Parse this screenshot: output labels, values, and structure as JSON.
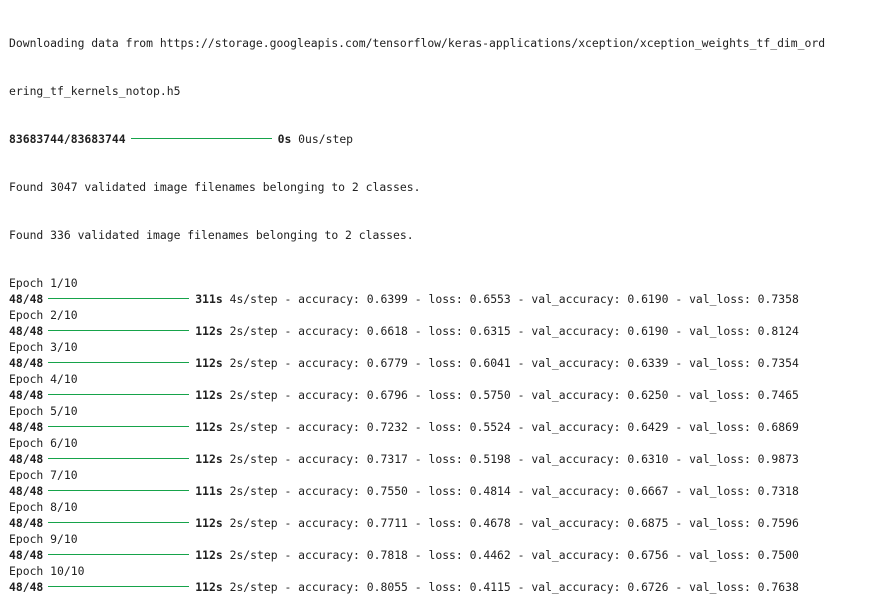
{
  "download": {
    "line1": "Downloading data from https://storage.googleapis.com/tensorflow/keras-applications/xception/xception_weights_tf_dim_ord",
    "line2": "ering_tf_kernels_notop.h5",
    "count": "83683744/83683744",
    "time": "0s",
    "rate": "0us/step"
  },
  "found": [
    "Found 3047 validated image filenames belonging to 2 classes.",
    "Found 336 validated image filenames belonging to 2 classes."
  ],
  "epochs": [
    {
      "label": "Epoch 1/10",
      "steps": "48/48",
      "time": "311s",
      "rate": "4s/step",
      "metrics": "- accuracy: 0.6399 - loss: 0.6553 - val_accuracy: 0.6190 - val_loss: 0.7358"
    },
    {
      "label": "Epoch 2/10",
      "steps": "48/48",
      "time": "112s",
      "rate": "2s/step",
      "metrics": "- accuracy: 0.6618 - loss: 0.6315 - val_accuracy: 0.6190 - val_loss: 0.8124"
    },
    {
      "label": "Epoch 3/10",
      "steps": "48/48",
      "time": "112s",
      "rate": "2s/step",
      "metrics": "- accuracy: 0.6779 - loss: 0.6041 - val_accuracy: 0.6339 - val_loss: 0.7354"
    },
    {
      "label": "Epoch 4/10",
      "steps": "48/48",
      "time": "112s",
      "rate": "2s/step",
      "metrics": "- accuracy: 0.6796 - loss: 0.5750 - val_accuracy: 0.6250 - val_loss: 0.7465"
    },
    {
      "label": "Epoch 5/10",
      "steps": "48/48",
      "time": "112s",
      "rate": "2s/step",
      "metrics": "- accuracy: 0.7232 - loss: 0.5524 - val_accuracy: 0.6429 - val_loss: 0.6869"
    },
    {
      "label": "Epoch 6/10",
      "steps": "48/48",
      "time": "112s",
      "rate": "2s/step",
      "metrics": "- accuracy: 0.7317 - loss: 0.5198 - val_accuracy: 0.6310 - val_loss: 0.9873"
    },
    {
      "label": "Epoch 7/10",
      "steps": "48/48",
      "time": "111s",
      "rate": "2s/step",
      "metrics": "- accuracy: 0.7550 - loss: 0.4814 - val_accuracy: 0.6667 - val_loss: 0.7318"
    },
    {
      "label": "Epoch 8/10",
      "steps": "48/48",
      "time": "112s",
      "rate": "2s/step",
      "metrics": "- accuracy: 0.7711 - loss: 0.4678 - val_accuracy: 0.6875 - val_loss: 0.7596"
    },
    {
      "label": "Epoch 9/10",
      "steps": "48/48",
      "time": "112s",
      "rate": "2s/step",
      "metrics": "- accuracy: 0.7818 - loss: 0.4462 - val_accuracy: 0.6756 - val_loss: 0.7500"
    },
    {
      "label": "Epoch 10/10",
      "steps": "48/48",
      "time": "112s",
      "rate": "2s/step",
      "metrics": "- accuracy: 0.8055 - loss: 0.4115 - val_accuracy: 0.6726 - val_loss: 0.7638"
    }
  ],
  "colors": {
    "progress_bar": "#16a34a",
    "text": "#212121",
    "background": "#ffffff"
  }
}
